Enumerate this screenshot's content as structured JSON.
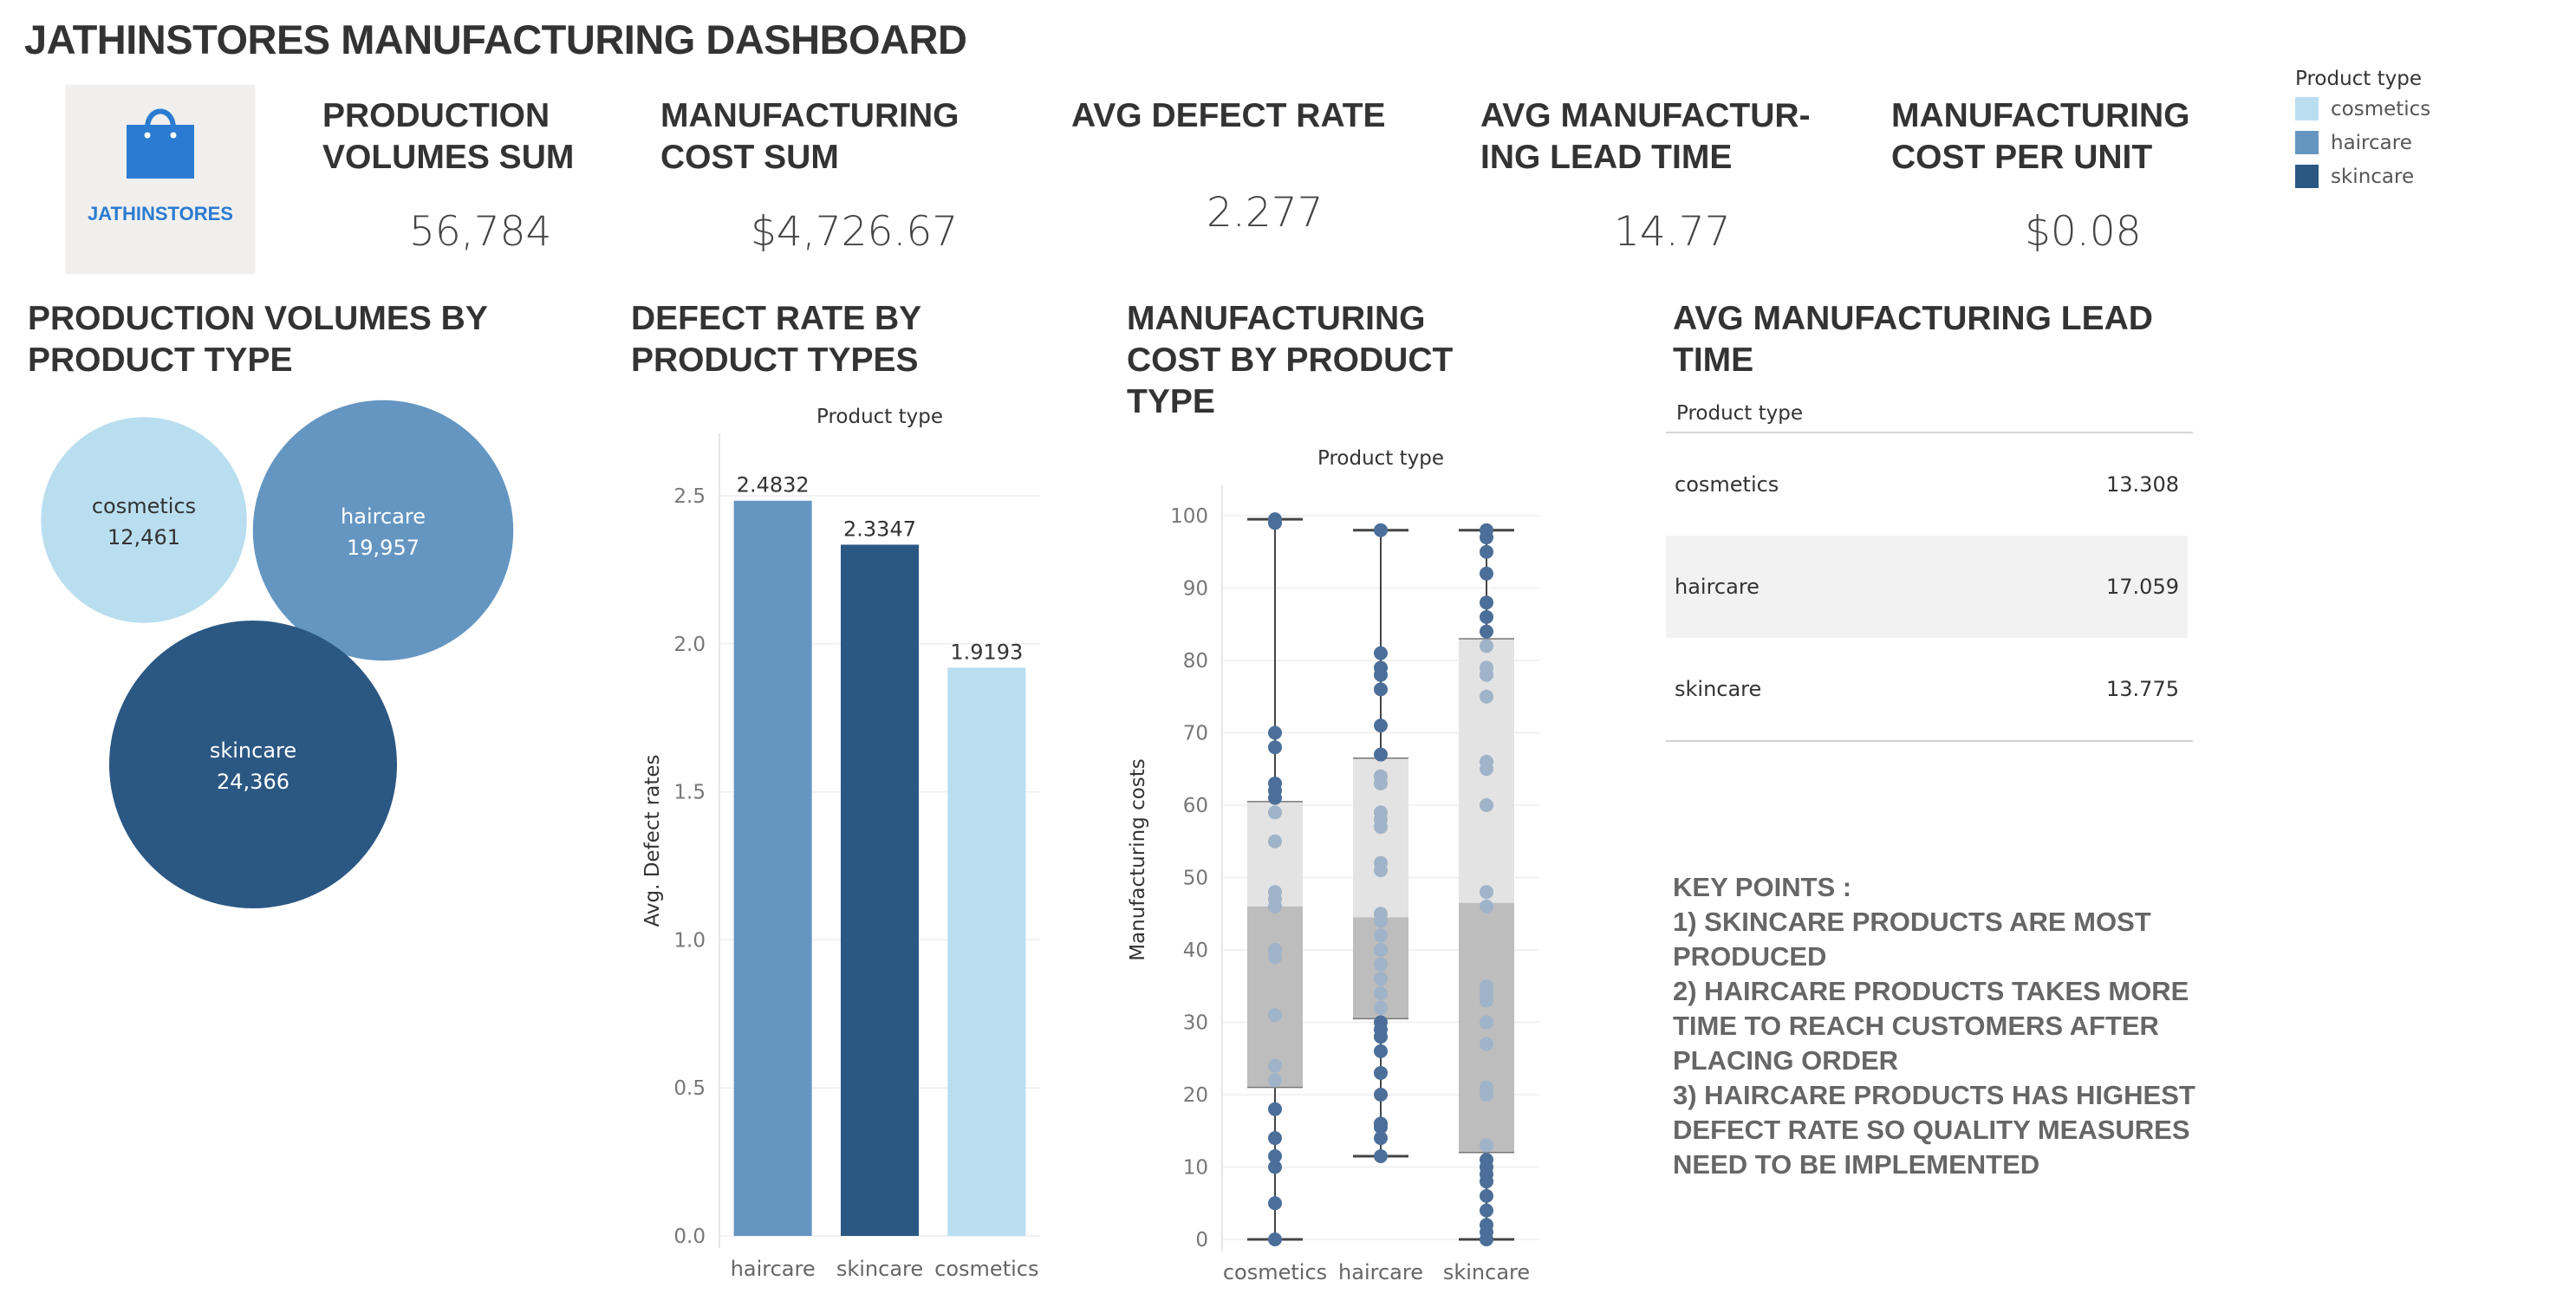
{
  "dashboard": {
    "title": "JATHINSTORES MANUFACTURING DASHBOARD"
  },
  "logo": {
    "text": "JATHINSTORES",
    "icon": "shopping-bag-icon",
    "color": "#2a7bd1"
  },
  "kpis": [
    {
      "label": "PRODUCTION\nVOLUMES SUM",
      "value": "56,784"
    },
    {
      "label": "MANUFACTURING\nCOST SUM",
      "value": "$4,726.67"
    },
    {
      "label": "AVG DEFECT RATE",
      "value": "2.277"
    },
    {
      "label": "AVG MANUFACTUR-\nING LEAD TIME",
      "value": "14.77"
    },
    {
      "label": "MANUFACTURING\nCOST PER UNIT",
      "value": "$0.08"
    }
  ],
  "legend": {
    "title": "Product type",
    "items": [
      {
        "label": "cosmetics",
        "color": "#b9def0"
      },
      {
        "label": "haircare",
        "color": "#6596c2"
      },
      {
        "label": "skincare",
        "color": "#2b5783"
      }
    ]
  },
  "sections": {
    "production": "PRODUCTION VOLUMES BY\nPRODUCT TYPE",
    "defect": "DEFECT RATE BY\nPRODUCT TYPES",
    "cost": "MANUFACTURING\nCOST BY PRODUCT\nTYPE",
    "lead": "AVG MANUFACTURING LEAD\nTIME"
  },
  "chart_data": [
    {
      "type": "bubble",
      "categories": [
        "cosmetics",
        "haircare",
        "skincare"
      ],
      "values": [
        12461,
        19957,
        24366
      ],
      "labels": [
        "12,461",
        "19,957",
        "24,366"
      ],
      "colors": [
        "#b9def0",
        "#6596c2",
        "#2b5783"
      ]
    },
    {
      "type": "bar",
      "header": "Product type",
      "categories": [
        "haircare",
        "skincare",
        "cosmetics"
      ],
      "values": [
        2.4832,
        2.3347,
        1.9193
      ],
      "value_labels": [
        "2.4832",
        "2.3347",
        "1.9193"
      ],
      "colors": [
        "#6596c2",
        "#2b5783",
        "#b9def0"
      ],
      "ylabel": "Avg. Defect rates",
      "ylim": [
        0,
        2.6
      ],
      "yticks": [
        "0.0",
        "0.5",
        "1.0",
        "1.5",
        "2.0",
        "2.5"
      ],
      "grid": true
    },
    {
      "type": "box",
      "header": "Product type",
      "categories": [
        "cosmetics",
        "haircare",
        "skincare"
      ],
      "ylabel": "Manufacturing costs",
      "ylim": [
        0,
        100
      ],
      "yticks": [
        "0",
        "10",
        "20",
        "30",
        "40",
        "50",
        "60",
        "70",
        "80",
        "90",
        "100"
      ],
      "grid": true,
      "boxes": [
        {
          "min": 0,
          "q1": 21,
          "median": 46,
          "q3": 60.5,
          "max": 99.5,
          "points": [
            0,
            5,
            10,
            11.5,
            14,
            18,
            22,
            24,
            31,
            39,
            40,
            46,
            47,
            48,
            55,
            59,
            61,
            62,
            63,
            68,
            70,
            99,
            99.5
          ]
        },
        {
          "min": 11.5,
          "q1": 30.5,
          "median": 44.5,
          "q3": 66.5,
          "max": 98,
          "points": [
            11.5,
            14,
            15.5,
            16,
            20,
            23,
            26,
            28,
            29,
            30,
            32,
            34,
            36,
            38,
            40,
            42,
            44,
            45,
            51,
            52,
            57,
            58,
            59,
            63,
            64,
            67,
            71,
            76,
            78,
            79,
            81,
            98
          ]
        },
        {
          "min": 0,
          "q1": 12,
          "median": 46.5,
          "q3": 83,
          "max": 98,
          "points": [
            0,
            1,
            2,
            4,
            6,
            8,
            9,
            10,
            11,
            13,
            20,
            21,
            27,
            30,
            33,
            34,
            35,
            46,
            48,
            60,
            65,
            66,
            75,
            78,
            79,
            82,
            84,
            86,
            88,
            92,
            95,
            97,
            98
          ]
        }
      ],
      "colors": {
        "box_upper": "#e3e3e3",
        "box_lower": "#bdbdbd",
        "points": "#4b6f98",
        "points_light": "#9fb3c9"
      }
    },
    {
      "type": "table",
      "header": "Product type",
      "rows": [
        {
          "label": "cosmetics",
          "value": "13.308"
        },
        {
          "label": "haircare",
          "value": "17.059"
        },
        {
          "label": "skincare",
          "value": "13.775"
        }
      ]
    }
  ],
  "key_points": {
    "heading": "KEY POINTS :",
    "lines": [
      "1) SKINCARE PRODUCTS ARE MOST PRODUCED",
      "2) HAIRCARE PRODUCTS TAKES  MORE TIME TO REACH CUSTOMERS AFTER PLACING ORDER",
      "3) HAIRCARE PRODUCTS HAS HIGHEST DEFECT RATE SO QUALITY MEASURES NEED TO BE IMPLEMENTED"
    ]
  }
}
